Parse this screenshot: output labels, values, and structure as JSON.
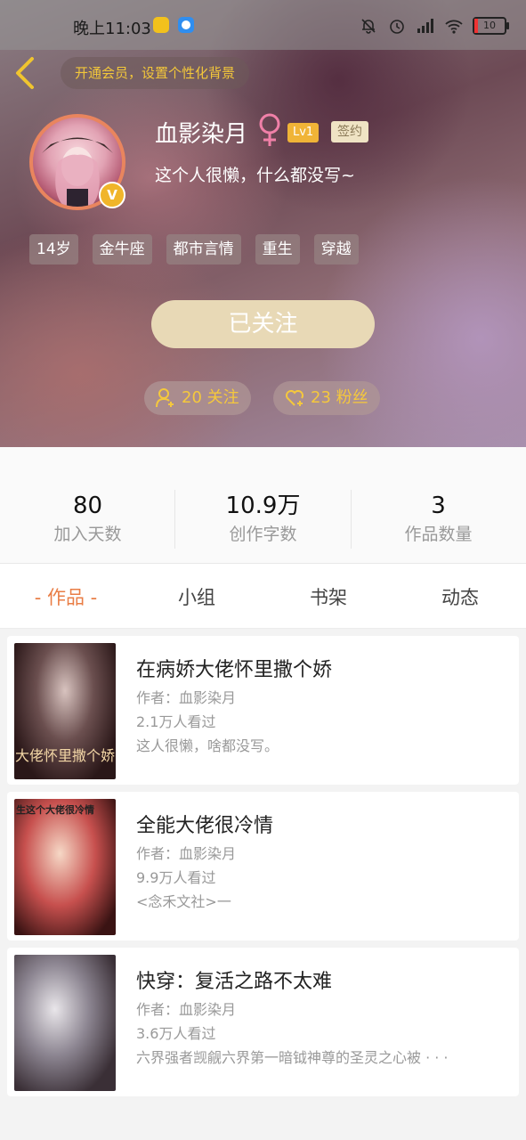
{
  "status_bar": {
    "time": "晚上11:03",
    "battery": "10"
  },
  "header": {
    "vip_banner": "开通会员，设置个性化背景",
    "username": "血影染月",
    "level": "Lv1",
    "sign_badge": "签约",
    "bio": "这个人很懒，什么都没写~",
    "tags": [
      "14岁",
      "金牛座",
      "都市言情",
      "重生",
      "穿越"
    ],
    "follow_button": "已关注",
    "following": "20 关注",
    "fans": "23 粉丝",
    "verified_badge": "V"
  },
  "stats": [
    {
      "value": "80",
      "label": "加入天数"
    },
    {
      "value": "10.9万",
      "label": "创作字数"
    },
    {
      "value": "3",
      "label": "作品数量"
    }
  ],
  "tabs": [
    "- 作品 -",
    "小组",
    "书架",
    "动态"
  ],
  "works": [
    {
      "title": "在病娇大佬怀里撒个娇",
      "author": "作者：血影染月",
      "views": "2.1万人看过",
      "desc": "这人很懒，啥都没写。",
      "cover_text": "大佬怀里撒个娇"
    },
    {
      "title": "全能大佬很冷情",
      "author": "作者：血影染月",
      "views": "9.9万人看过",
      "desc": "<念禾文社>一",
      "cover_text": "生这个大佬很冷情"
    },
    {
      "title": "快穿：复活之路不太难",
      "author": "作者：血影染月",
      "views": "3.6万人看过",
      "desc": "六界强者觊觎六界第一暗钺神尊的圣灵之心被 · · ·",
      "cover_text": ""
    }
  ],
  "colors": {
    "accent": "#e97d45",
    "gold": "#f3c73a",
    "follow_btn": "#e8d9b6"
  }
}
